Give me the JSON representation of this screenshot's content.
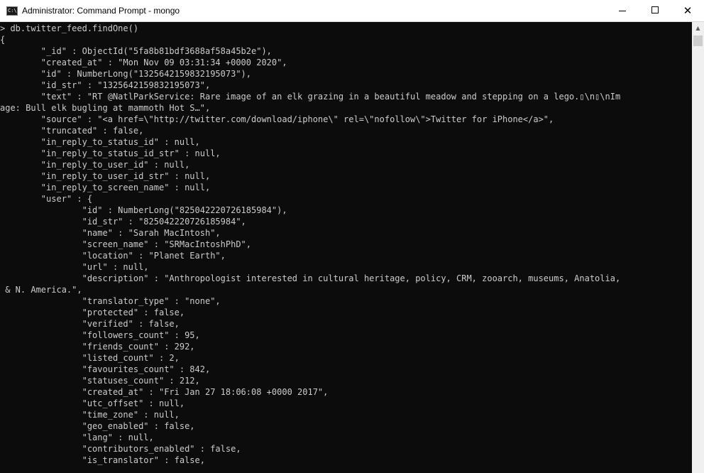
{
  "window": {
    "title": "Administrator: Command Prompt - mongo",
    "icon_label": "C:\\",
    "controls": {
      "minimize_icon": "minimize-icon",
      "maximize_icon": "maximize-icon",
      "close_glyph": "✕"
    }
  },
  "console": {
    "lines": [
      "> db.twitter_feed.findOne()",
      "{",
      "        \"_id\" : ObjectId(\"5fa8b81bdf3688af58a45b2e\"),",
      "        \"created_at\" : \"Mon Nov 09 03:31:34 +0000 2020\",",
      "        \"id\" : NumberLong(\"1325642159832195073\"),",
      "        \"id_str\" : \"1325642159832195073\",",
      "        \"text\" : \"RT @NatlParkService: Rare image of an elk grazing in a beautiful meadow and stepping on a lego.▯\\n▯\\nIm",
      "age: Bull elk bugling at mammoth Hot S…\",",
      "        \"source\" : \"<a href=\\\"http://twitter.com/download/iphone\\\" rel=\\\"nofollow\\\">Twitter for iPhone</a>\",",
      "        \"truncated\" : false,",
      "        \"in_reply_to_status_id\" : null,",
      "        \"in_reply_to_status_id_str\" : null,",
      "        \"in_reply_to_user_id\" : null,",
      "        \"in_reply_to_user_id_str\" : null,",
      "        \"in_reply_to_screen_name\" : null,",
      "        \"user\" : {",
      "                \"id\" : NumberLong(\"825042220726185984\"),",
      "                \"id_str\" : \"825042220726185984\",",
      "                \"name\" : \"Sarah MacIntosh\",",
      "                \"screen_name\" : \"SRMacIntoshPhD\",",
      "                \"location\" : \"Planet Earth\",",
      "                \"url\" : null,",
      "                \"description\" : \"Anthropologist interested in cultural heritage, policy, CRM, zooarch, museums, Anatolia,",
      " & N. America.\",",
      "                \"translator_type\" : \"none\",",
      "                \"protected\" : false,",
      "                \"verified\" : false,",
      "                \"followers_count\" : 95,",
      "                \"friends_count\" : 292,",
      "                \"listed_count\" : 2,",
      "                \"favourites_count\" : 842,",
      "                \"statuses_count\" : 212,",
      "                \"created_at\" : \"Fri Jan 27 18:06:08 +0000 2017\",",
      "                \"utc_offset\" : null,",
      "                \"time_zone\" : null,",
      "                \"geo_enabled\" : false,",
      "                \"lang\" : null,",
      "                \"contributors_enabled\" : false,",
      "                \"is_translator\" : false,"
    ]
  },
  "colors": {
    "console_background": "#0c0c0c",
    "console_text": "#cccccc",
    "titlebar_background": "#ffffff"
  }
}
